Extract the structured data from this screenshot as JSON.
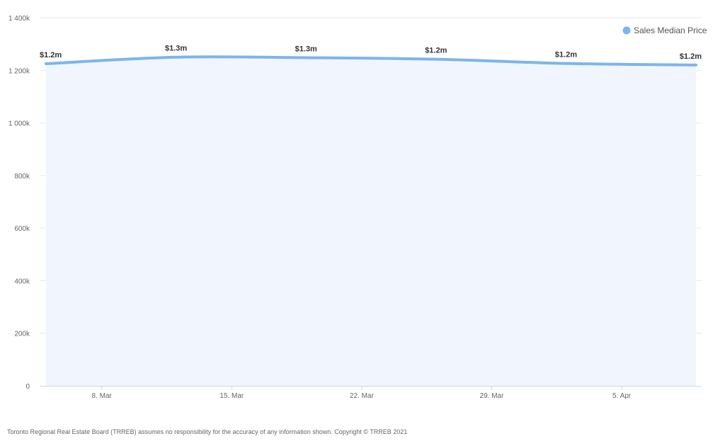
{
  "colors": {
    "series": "#7cb5ec",
    "area_fill": "#f1f5fd",
    "grid": "#e6e6e6",
    "axis": "#ccd6eb"
  },
  "chart_data": {
    "type": "area",
    "title": "",
    "xlabel": "",
    "ylabel": "",
    "x_tick_labels": [
      "8. Mar",
      "15. Mar",
      "22. Mar",
      "29. Mar",
      "5. Apr"
    ],
    "y_tick_labels": [
      "0",
      "200k",
      "400k",
      "600k",
      "800k",
      "1 000k",
      "1 200k",
      "1 400k"
    ],
    "y_ticks": [
      0,
      200000,
      400000,
      600000,
      800000,
      1000000,
      1200000,
      1400000
    ],
    "ylim": [
      0,
      1400000
    ],
    "legend_position": "top-right",
    "grid": true,
    "series": [
      {
        "name": "Sales Median Price",
        "x": [
          "2021-03-05",
          "2021-03-12",
          "2021-03-19",
          "2021-03-26",
          "2021-04-02",
          "2021-04-09"
        ],
        "values": [
          1225000,
          1250000,
          1248000,
          1242000,
          1226000,
          1220000
        ],
        "data_labels": [
          "$1.2m",
          "$1.3m",
          "$1.3m",
          "$1.2m",
          "$1.2m",
          "$1.2m"
        ]
      }
    ]
  },
  "footer": {
    "disclaimer": "Toronto Regional Real Estate Board (TRREB) assumes no responsibility for the accuracy of any information shown. Copyright © TRREB 2021"
  }
}
